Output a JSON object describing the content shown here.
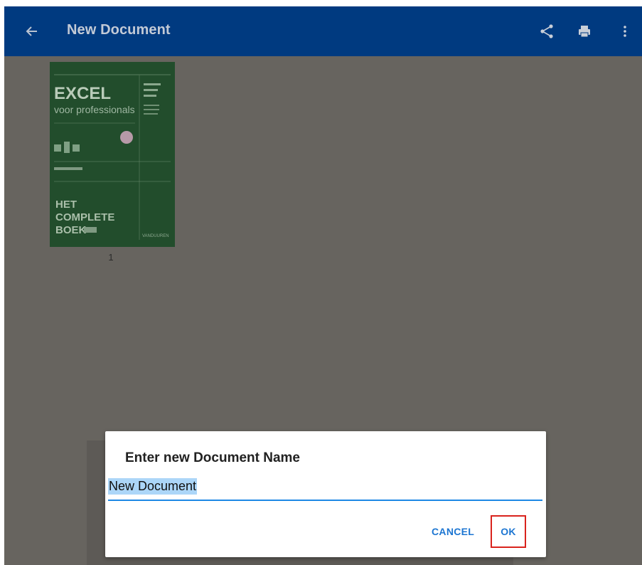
{
  "appbar": {
    "title": "New Document",
    "back_icon": "arrow-left-icon",
    "actions": [
      "share-icon",
      "print-icon",
      "more-vert-icon"
    ],
    "bg_color": "#003a80"
  },
  "document": {
    "pages": [
      {
        "number": "1",
        "cover_text": {
          "title": "EXCEL",
          "subtitle": "voor professionals",
          "bottom": [
            "HET",
            "COMPLETE",
            "BOEK"
          ],
          "publisher": "VANDUUREN"
        }
      }
    ]
  },
  "dialog": {
    "title": "Enter new Document Name",
    "input_value": "New Document",
    "cancel_label": "CANCEL",
    "ok_label": "OK",
    "accent_color": "#1d76d2",
    "highlight_color": "#d9231d"
  }
}
